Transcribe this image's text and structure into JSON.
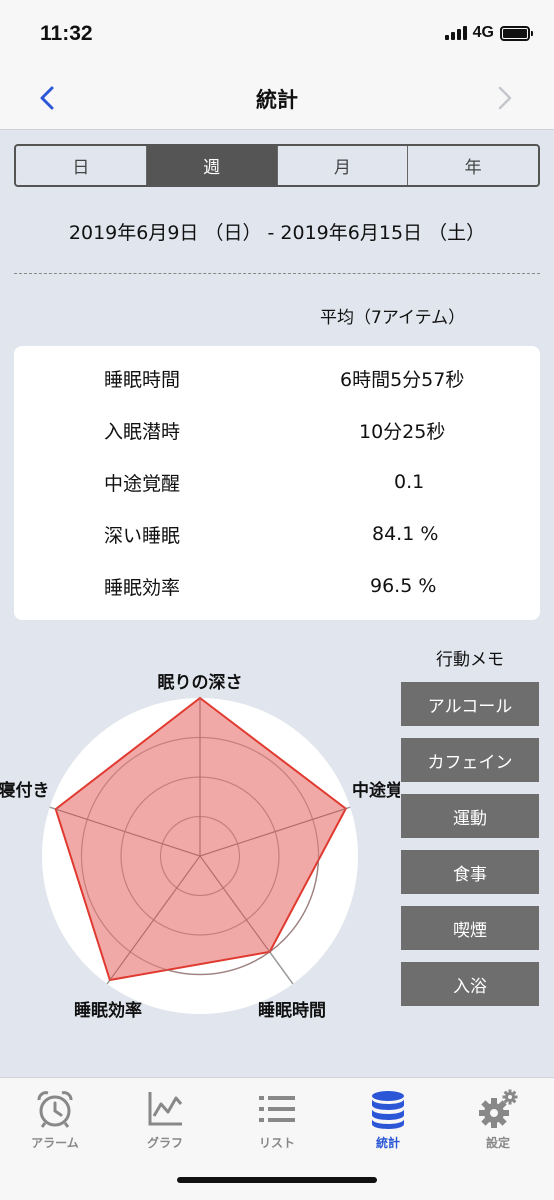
{
  "status_bar": {
    "time": "11:32",
    "network": "4G"
  },
  "nav": {
    "title": "統計"
  },
  "segments": [
    {
      "label": "日",
      "active": false
    },
    {
      "label": "週",
      "active": true
    },
    {
      "label": "月",
      "active": false
    },
    {
      "label": "年",
      "active": false
    }
  ],
  "date_range": "2019年6月9日 （日） - 2019年6月15日 （土）",
  "average_label": "平均（7アイテム）",
  "stats": [
    {
      "label": "睡眠時間",
      "value": "6時間5分57秒"
    },
    {
      "label": "入眠潜時",
      "value": "10分25秒"
    },
    {
      "label": "中途覚醒",
      "value": "0.1"
    },
    {
      "label": "深い睡眠",
      "value": "84.1 %"
    },
    {
      "label": "睡眠効率",
      "value": "96.5 %"
    }
  ],
  "radar": {
    "axes": [
      "眠りの深さ",
      "中途覚醒",
      "睡眠時間",
      "睡眠効率",
      "寝付き"
    ],
    "values": [
      1.0,
      0.97,
      0.75,
      0.97,
      0.96
    ],
    "fill_color": "#ee9a98",
    "stroke_color": "#e03a30"
  },
  "memo": {
    "title": "行動メモ",
    "buttons": [
      "アルコール",
      "カフェイン",
      "運動",
      "食事",
      "喫煙",
      "入浴"
    ]
  },
  "tabs": [
    {
      "label": "アラーム",
      "icon": "alarm-clock-icon",
      "active": false
    },
    {
      "label": "グラフ",
      "icon": "line-chart-icon",
      "active": false
    },
    {
      "label": "リスト",
      "icon": "list-icon",
      "active": false
    },
    {
      "label": "統計",
      "icon": "database-icon",
      "active": true
    },
    {
      "label": "設定",
      "icon": "gear-icon",
      "active": false
    }
  ],
  "colors": {
    "accent": "#2b57d6",
    "segment_active": "#555555",
    "memo_button": "#6e6e6e"
  }
}
